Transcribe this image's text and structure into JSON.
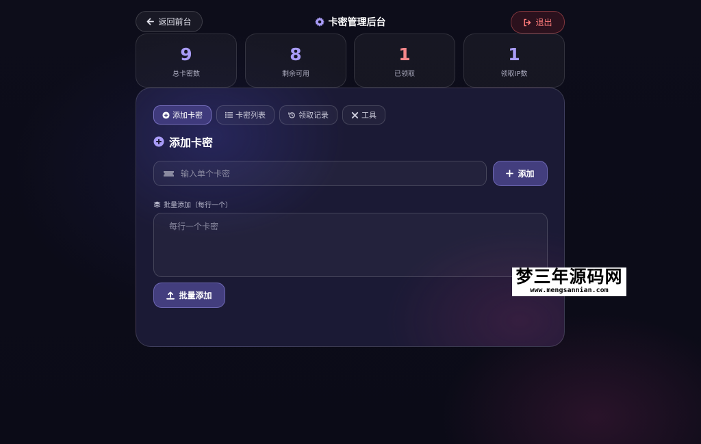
{
  "header": {
    "back_label": "返回前台",
    "title": "卡密管理后台",
    "logout_label": "退出"
  },
  "stats": [
    {
      "value": "9",
      "label": "总卡密数"
    },
    {
      "value": "8",
      "label": "剩余可用"
    },
    {
      "value": "1",
      "label": "已领取"
    },
    {
      "value": "1",
      "label": "领取IP数"
    }
  ],
  "tabs": [
    {
      "label": "添加卡密",
      "icon": "plus-circle-icon",
      "active": true
    },
    {
      "label": "卡密列表",
      "icon": "list-icon",
      "active": false
    },
    {
      "label": "领取记录",
      "icon": "history-icon",
      "active": false
    },
    {
      "label": "工具",
      "icon": "tools-icon",
      "active": false
    }
  ],
  "add_section": {
    "title": "添加卡密",
    "single_placeholder": "输入单个卡密",
    "add_button": "添加",
    "batch_label": "批量添加（每行一个）",
    "batch_placeholder": "每行一个卡密",
    "batch_button": "批量添加"
  },
  "watermark": {
    "main": "梦三年源码网",
    "sub": "www.mengsannian.com"
  },
  "colors": {
    "accent": "#a99cf7",
    "button": "#433e7e",
    "danger": "#ff7b7b",
    "panel": "#1b1a35"
  }
}
